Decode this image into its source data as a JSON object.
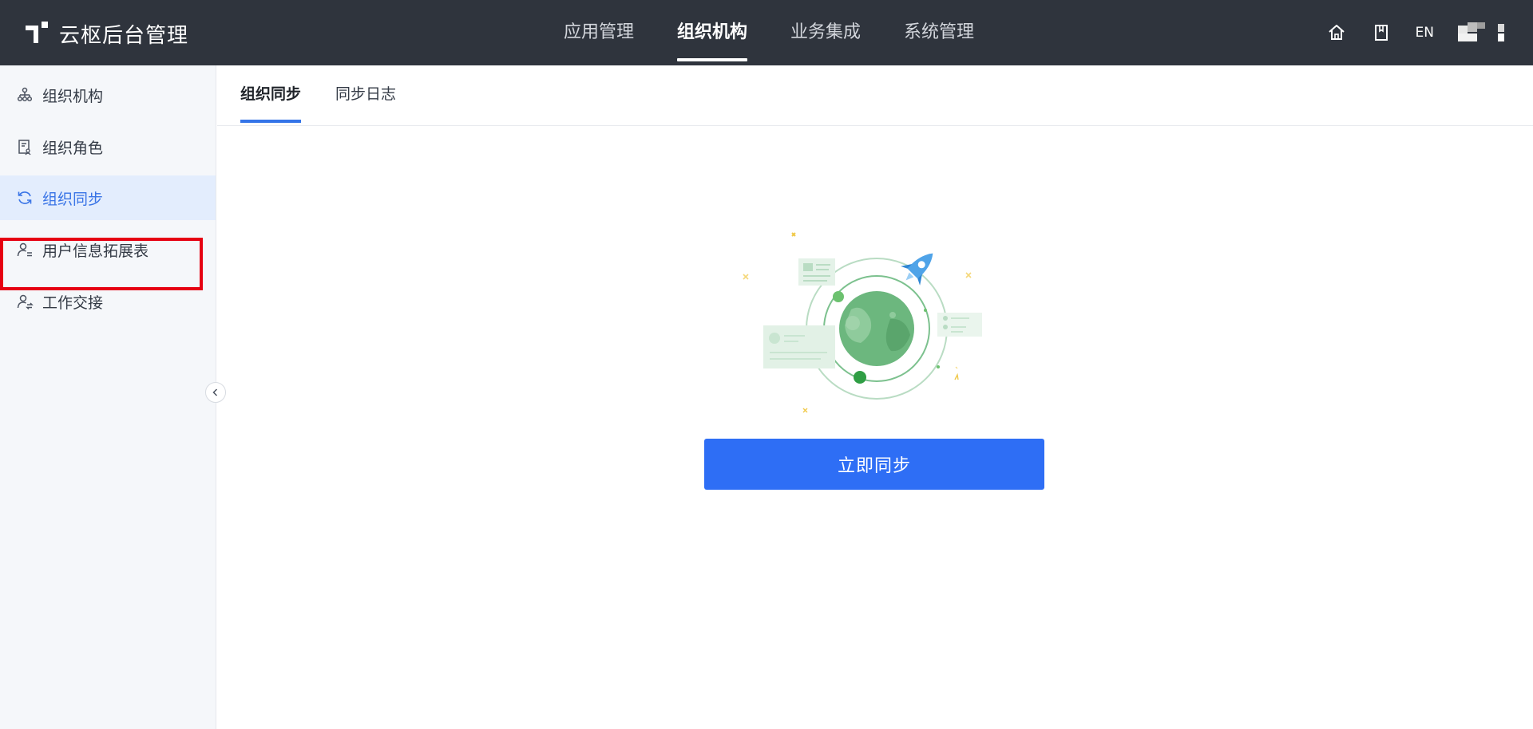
{
  "brand": {
    "title": "云枢后台管理"
  },
  "topnav": {
    "items": [
      {
        "label": "应用管理"
      },
      {
        "label": "组织机构"
      },
      {
        "label": "业务集成"
      },
      {
        "label": "系统管理"
      }
    ],
    "active": "组织机构"
  },
  "top_actions": {
    "home_icon": "home-icon",
    "book_icon": "book-icon",
    "lang": "EN"
  },
  "sidebar": {
    "items": [
      {
        "label": "组织机构",
        "icon": "org-tree-icon"
      },
      {
        "label": "组织角色",
        "icon": "role-doc-icon"
      },
      {
        "label": "组织同步",
        "icon": "sync-icon"
      },
      {
        "label": "用户信息拓展表",
        "icon": "user-list-icon"
      },
      {
        "label": "工作交接",
        "icon": "user-handover-icon"
      }
    ],
    "active": "组织同步"
  },
  "tabs": {
    "items": [
      {
        "label": "组织同步"
      },
      {
        "label": "同步日志"
      }
    ],
    "active": "组织同步"
  },
  "main": {
    "sync_button_label": "立即同步",
    "illustration_icon": "globe-rocket-illustration"
  },
  "colors": {
    "header_bg": "#2f343d",
    "accent": "#2e6ef5",
    "sidebar_bg": "#f5f7fa",
    "sidebar_active_bg": "#e3edfd",
    "highlight_border": "#e60012",
    "illustration_green": "#6cb77e"
  }
}
